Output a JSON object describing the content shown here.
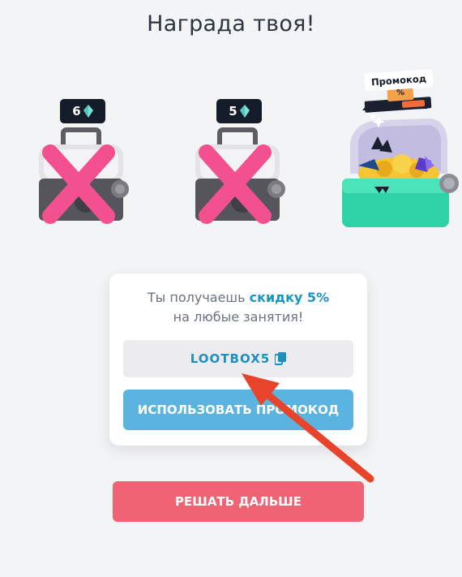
{
  "header": {
    "title": "Награда твоя!"
  },
  "chests": [
    {
      "gems": "6",
      "state": "crossed-out",
      "gem_icon": "gem-icon"
    },
    {
      "gems": "5",
      "state": "crossed-out",
      "gem_icon": "gem-icon"
    },
    {
      "badge": "Промокод",
      "badge_symbol": "%",
      "state": "open-treasure"
    }
  ],
  "reward_card": {
    "text_prefix": "Ты получаешь ",
    "text_accent": "скидку 5%",
    "text_line2": "на любые занятия!",
    "promo_code": "LOOTBOX5",
    "copy_icon": "copy-icon",
    "use_button": "ИСПОЛЬЗОВАТЬ ПРОМОКОД"
  },
  "continue_button": "РЕШАТЬ ДАЛЬШЕ",
  "colors": {
    "background": "#f3f4f6",
    "accent_blue": "#1996c4",
    "use_button": "#5bb4e0",
    "continue_button": "#f06375",
    "annotation_arrow": "#e8442c",
    "cross_mark": "#f2508e"
  }
}
